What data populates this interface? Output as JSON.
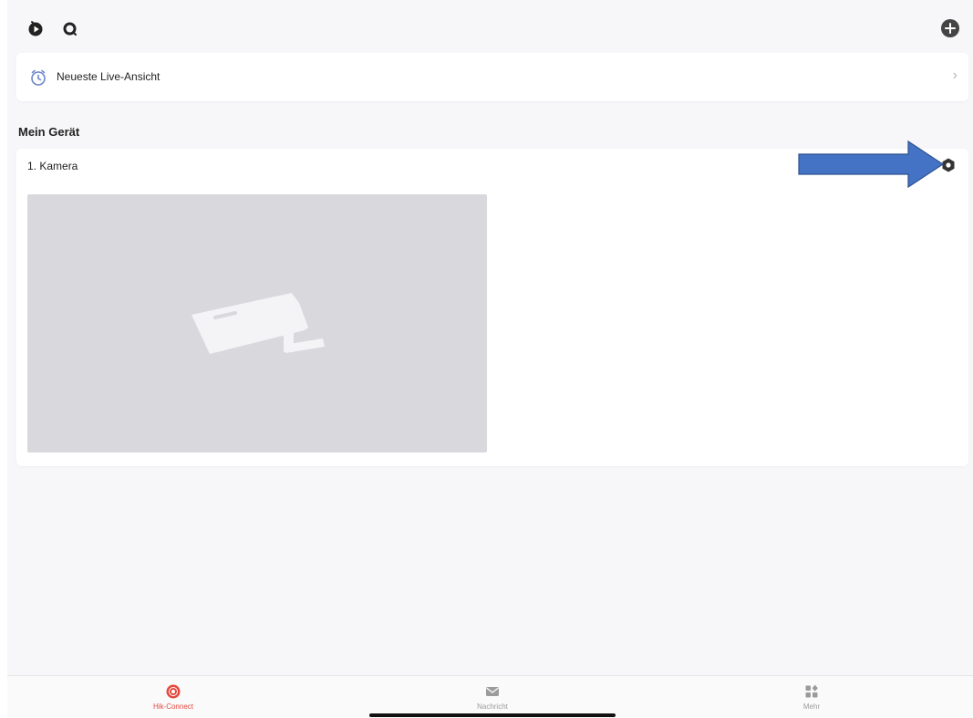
{
  "recent": {
    "label": "Neueste Live-Ansicht",
    "chevron": "›"
  },
  "section": {
    "title": "Mein Gerät"
  },
  "device": {
    "name": "1. Kamera"
  },
  "tabs": [
    {
      "label": "Hik-Connect",
      "icon": "hik-connect-icon",
      "active": true
    },
    {
      "label": "Nachricht",
      "icon": "envelope-icon",
      "active": false
    },
    {
      "label": "Mehr",
      "icon": "grid-icon",
      "active": false
    }
  ],
  "colors": {
    "accent": "#e5483e",
    "background": "#f7f7f9",
    "card": "#ffffff",
    "callout_arrow": "#4472c4",
    "clock_icon": "#6b86c8"
  },
  "icons": {
    "top_left_1": "playback-icon",
    "top_left_2": "search-icon",
    "top_right": "add-circle-icon",
    "recent": "clock-icon",
    "device_settings": "gear-icon",
    "preview_placeholder": "camera-placeholder-icon"
  }
}
